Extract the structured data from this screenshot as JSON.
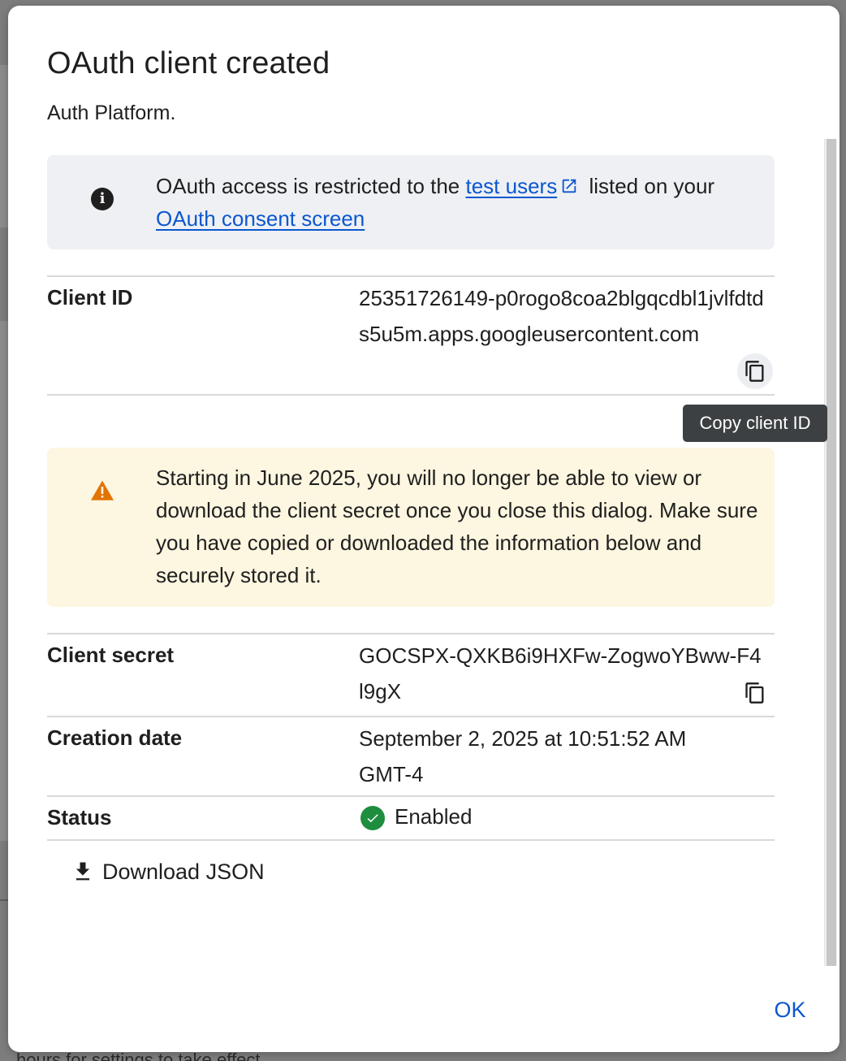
{
  "dialog": {
    "title": "OAuth client created",
    "subtitle": "Auth Platform."
  },
  "info_banner": {
    "icon": "info-icon",
    "text_before": "OAuth access is restricted to the ",
    "link1": "test users",
    "text_middle": " listed on your ",
    "link2": "OAuth consent screen"
  },
  "client_id": {
    "label": "Client ID",
    "value": "25351726149-p0rogo8coa2blgqcdbl1jvlfdtds5u5m.apps.googleusercontent.com",
    "copy_icon": "copy-icon"
  },
  "tooltip": "Copy client ID",
  "warning_banner": {
    "icon": "warning-icon",
    "text": "Starting in June 2025, you will no longer be able to view or download the client secret once you close this dialog. Make sure you have copied or downloaded the information below and securely stored it."
  },
  "client_secret": {
    "label": "Client secret",
    "value": "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"
  },
  "creation_date": {
    "label": "Creation date",
    "value": "September 2, 2025 at 10:51:52 AM GMT-4"
  },
  "status": {
    "label": "Status",
    "value": "Enabled"
  },
  "actions": {
    "download": "Download JSON",
    "ok": "OK"
  },
  "background": {
    "partial_text": "hours for settings to take effect"
  },
  "colors": {
    "link": "#0b57d0",
    "info_bg": "#eef0f4",
    "warn_bg": "#fdf6e0",
    "warn_icon": "#e37400",
    "success": "#1e8e3e"
  }
}
